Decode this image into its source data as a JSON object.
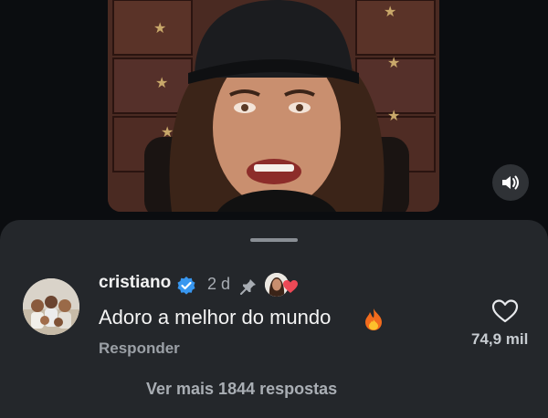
{
  "comment": {
    "username": "cristiano",
    "time": "2 d",
    "text": "Adoro a melhor do mundo",
    "reply_label": "Responder",
    "like_count": "74,9 mil",
    "view_more": "Ver mais 1844 respostas"
  },
  "icons": {
    "mute": "speaker-icon",
    "verified": "verified-badge-icon",
    "pin": "pin-icon",
    "emoji": "fire-emoji",
    "like": "heart-outline-icon"
  },
  "colors": {
    "verified": "#3897f0",
    "liked_heart": "#ed4956",
    "sheet_bg": "#24272b"
  }
}
